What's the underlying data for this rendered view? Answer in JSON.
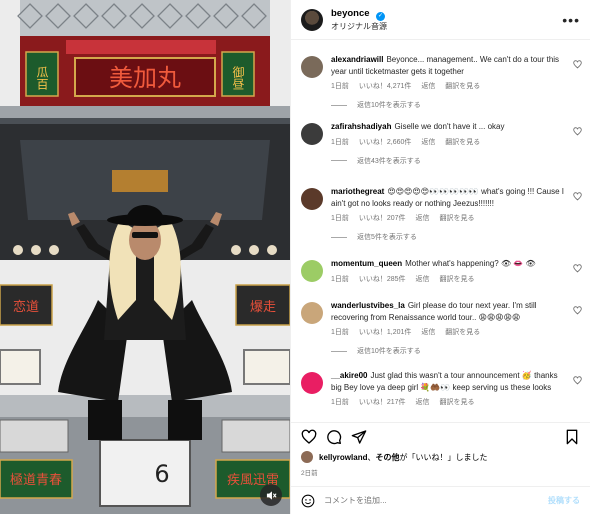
{
  "post": {
    "username": "beyonce",
    "audio": "オリジナル音源",
    "more_icon": "more-horizontal-icon"
  },
  "comments": [
    {
      "username": "alexandriawill",
      "text": "Beyonce... management.. We can't do a tour this year until ticketmaster gets it together",
      "time": "1日前",
      "likes": "いいね！4,271件",
      "reply": "返信",
      "translate": "翻訳を見る",
      "replies": "返信10件を表示する",
      "avatar_color": "#7a6a5a"
    },
    {
      "username": "zafirahshadiyah",
      "text": "Giselle we don't have it ... okay",
      "time": "1日前",
      "likes": "いいね！2,660件",
      "reply": "返信",
      "translate": "翻訳を見る",
      "replies": "返信43件を表示する",
      "avatar_color": "#3b3b3b"
    },
    {
      "username": "mariothegreat",
      "text": "😍😍😍😍😍👀👀👀👀👀 what's going !!! Cause I ain't got no looks ready or nothing Jeezus!!!!!!!",
      "time": "1日前",
      "likes": "いいね！207件",
      "reply": "返信",
      "translate": "翻訳を見る",
      "replies": "返信5件を表示する",
      "avatar_color": "#5b3a2a"
    },
    {
      "username": "momentum_queen",
      "text": "Mother what's happening? 👁 👄 👁",
      "time": "1日前",
      "likes": "いいね！285件",
      "reply": "返信",
      "translate": "翻訳を見る",
      "replies": "",
      "avatar_color": "#9ccc65"
    },
    {
      "username": "wanderlustvibes_la",
      "text": "Girl please do tour next year. I'm still recovering from Renaissance world tour.. 😩😩😩😩😩",
      "time": "1日前",
      "likes": "いいね！1,201件",
      "reply": "返信",
      "translate": "翻訳を見る",
      "replies": "返信10件を表示する",
      "avatar_color": "#c9a67a"
    },
    {
      "username": "__akire00",
      "text": "Just glad this wasn't a tour announcement 🥳 thanks big Bey love ya deep girl 💐🤲🏾👀 keep serving us these looks",
      "time": "1日前",
      "likes": "いいね！217件",
      "reply": "返信",
      "translate": "翻訳を見る",
      "replies": "",
      "avatar_color": "#e91e63"
    }
  ],
  "likes_line": {
    "user": "kellyrowland",
    "middle": "、",
    "others": "その他",
    "suffix": "が「いいね！」しました"
  },
  "date": "2日前",
  "comment_box": {
    "placeholder": "コメントを追加...",
    "post": "投稿する"
  },
  "truck_signs": {
    "top": "美加丸",
    "top_left": "瓜百",
    "top_right": "御昼",
    "mid_left": "恋道",
    "mid_right": "爆走",
    "bottom_left": "極道青春",
    "bottom_right": "疾風迅雷",
    "plate": "6"
  },
  "icons": [
    "heart-icon",
    "comment-icon",
    "share-icon",
    "bookmark-icon",
    "smile-icon",
    "mute-icon"
  ]
}
